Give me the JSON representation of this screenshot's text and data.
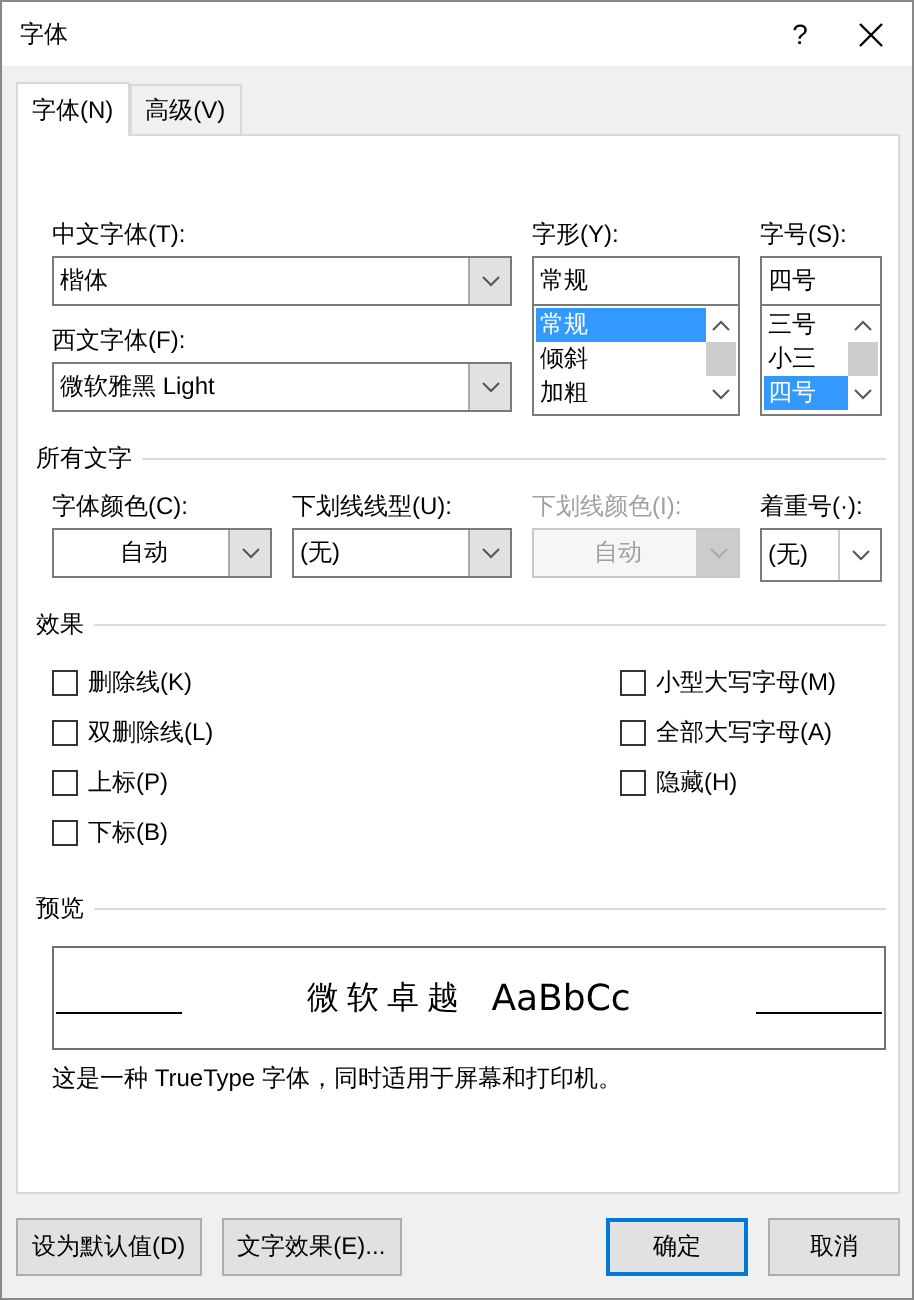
{
  "window": {
    "title": "字体",
    "help": "?"
  },
  "tabs": [
    {
      "label": "字体(N)",
      "selected": true
    },
    {
      "label": "高级(V)",
      "selected": false
    }
  ],
  "font": {
    "chinese_font": {
      "label": "中文字体(T):",
      "value": "楷体"
    },
    "western_font": {
      "label": "西文字体(F):",
      "value": "微软雅黑 Light"
    },
    "style": {
      "label": "字形(Y):",
      "value": "常规",
      "options": [
        {
          "label": "常规",
          "selected": true
        },
        {
          "label": "倾斜",
          "selected": false
        },
        {
          "label": "加粗",
          "selected": false
        }
      ]
    },
    "size": {
      "label": "字号(S):",
      "value": "四号",
      "options": [
        {
          "label": "三号",
          "selected": false
        },
        {
          "label": "小三",
          "selected": false
        },
        {
          "label": "四号",
          "selected": true
        }
      ]
    }
  },
  "all_text": {
    "heading": "所有文字",
    "fields": [
      {
        "label": "字体颜色(C):",
        "value": "自动",
        "kind": "color",
        "disabled": false
      },
      {
        "label": "下划线线型(U):",
        "value": "(无)",
        "kind": "list",
        "disabled": false
      },
      {
        "label": "下划线颜色(I):",
        "value": "自动",
        "kind": "color",
        "disabled": true
      },
      {
        "label": "着重号(·):",
        "value": "(无)",
        "kind": "list",
        "disabled": false
      }
    ]
  },
  "effects": {
    "heading": "效果",
    "columns": [
      [
        {
          "label": "删除线(K)",
          "checked": false
        },
        {
          "label": "双删除线(L)",
          "checked": false
        },
        {
          "label": "上标(P)",
          "checked": false
        },
        {
          "label": "下标(B)",
          "checked": false
        }
      ],
      [
        {
          "label": "小型大写字母(M)",
          "checked": false
        },
        {
          "label": "全部大写字母(A)",
          "checked": false
        },
        {
          "label": "隐藏(H)",
          "checked": false
        }
      ]
    ]
  },
  "preview": {
    "heading": "预览",
    "sample_cjk": "微软卓越",
    "sample_latin": "AaBbCc",
    "note": "这是一种 TrueType 字体，同时适用于屏幕和打印机。"
  },
  "buttons": [
    {
      "label": "设为默认值(D)",
      "default": false
    },
    {
      "label": "文字效果(E)...",
      "default": false
    },
    {
      "label": "确定",
      "default": true
    },
    {
      "label": "取消",
      "default": false
    }
  ]
}
